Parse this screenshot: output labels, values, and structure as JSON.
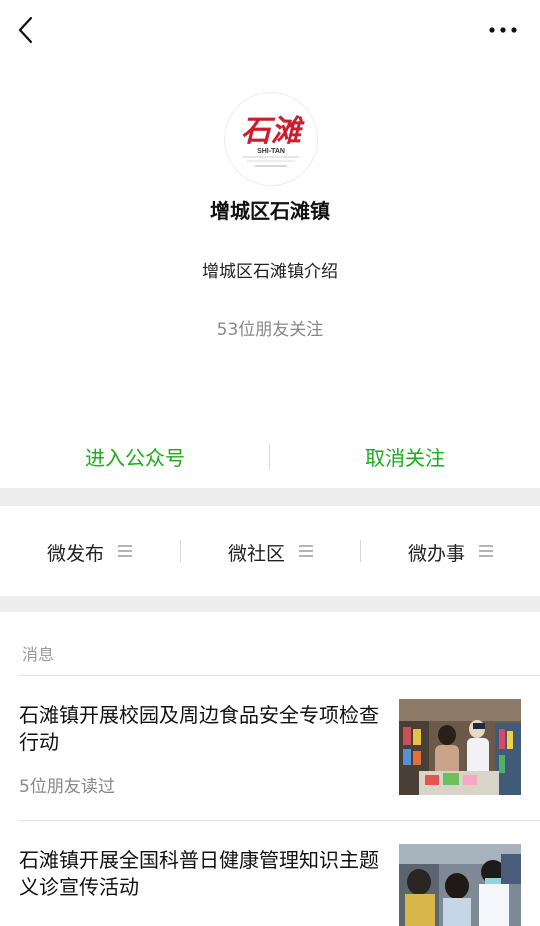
{
  "account": {
    "name": "增城区石滩镇",
    "description": "增城区石滩镇介绍",
    "followers_text": "53位朋友关注",
    "logo_text": "石滩",
    "logo_sub": "SHI-TAN"
  },
  "actions": {
    "enter_label": "进入公众号",
    "unfollow_label": "取消关注"
  },
  "menu": {
    "items": [
      {
        "label": "微发布"
      },
      {
        "label": "微社区"
      },
      {
        "label": "微办事"
      }
    ]
  },
  "messages": {
    "section_label": "消息",
    "articles": [
      {
        "title": "石滩镇开展校园及周边食品安全专项检查行动",
        "meta": "5位朋友读过"
      },
      {
        "title": "石滩镇开展全国科普日健康管理知识主题义诊宣传活动"
      }
    ]
  },
  "colors": {
    "accent_green": "#1aad19",
    "logo_red": "#c8202e",
    "divider_gray": "#ededed"
  },
  "icons": [
    "back-arrow-icon",
    "more-dots-icon",
    "menu-lines-icon"
  ]
}
